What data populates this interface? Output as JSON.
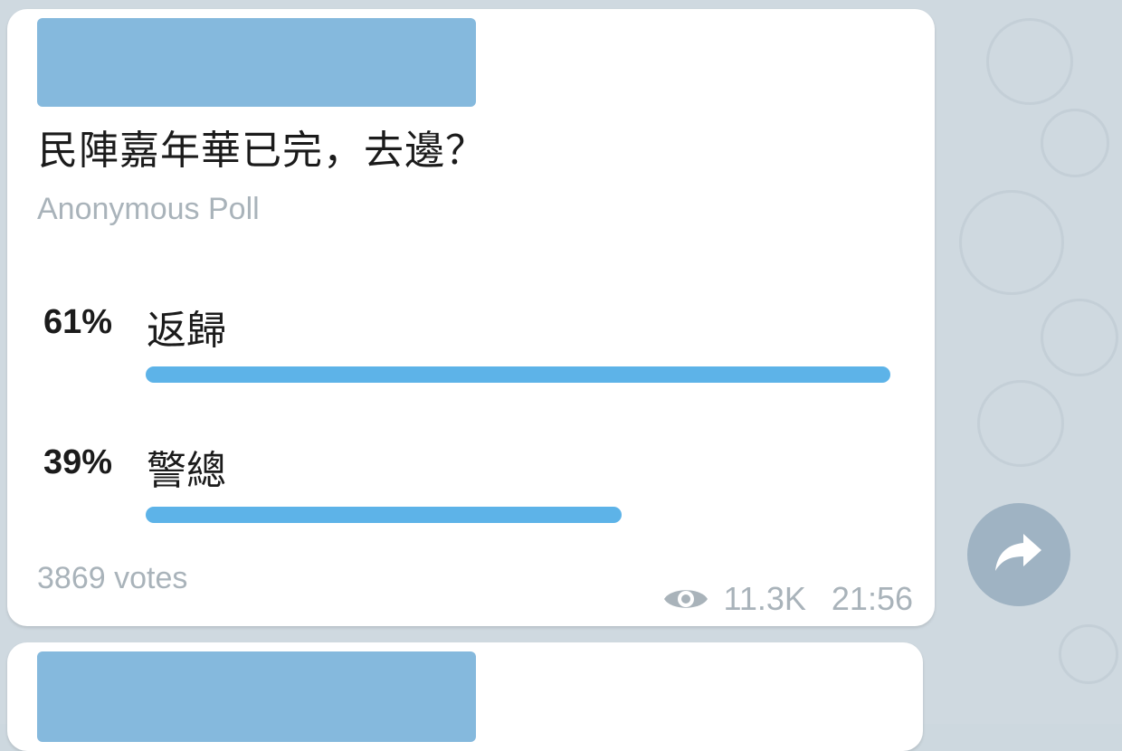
{
  "poll": {
    "question": "民陣嘉年華已完，去邊？",
    "type_label": "Anonymous Poll",
    "options": [
      {
        "percent_label": "61%",
        "label": "返歸",
        "share": 0.61
      },
      {
        "percent_label": "39%",
        "label": "警總",
        "share": 0.39
      }
    ],
    "votes_label": "3869 votes",
    "views": "11.3K",
    "time": "21:56"
  },
  "colors": {
    "chat_background": "#cfd9e0",
    "bubble": "#ffffff",
    "bar": "#5db3e8",
    "redaction": "#85b9dd",
    "secondary_text": "#a9b3ba",
    "share_button": "#9fb3c3"
  },
  "icons": {
    "views": "eye-icon",
    "share": "share-arrow-icon"
  }
}
